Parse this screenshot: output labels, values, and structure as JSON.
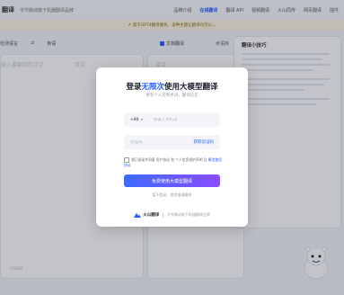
{
  "nav": {
    "brand": "翻译",
    "tagline": "字节跳动旗下机器翻译品牌",
    "menu": [
      "品牌介绍",
      "在线翻译",
      "翻译 API",
      "视频翻译",
      "火山同传",
      "网页翻译",
      "插件"
    ]
  },
  "notice": "✐ 基于GPT4翻译服务，多种主题让翻译也可以...",
  "toolbar": {
    "source_lang": "检测语言",
    "target_lang": "英语",
    "auto_label": "文档翻译",
    "glossary": "术语库"
  },
  "left_panel": {
    "placeholder": "输入要翻译的文字",
    "target_placeholder": "译文",
    "count": "0/5000"
  },
  "mid_panel": {
    "placeholder": "译文"
  },
  "tips": {
    "title": "翻译小技巧"
  },
  "modal": {
    "headline_pre": "登录",
    "headline_highlight": "无限次",
    "headline_post": "使用大模型翻译",
    "subtitle": "更有个人定制术语，翻译历史",
    "phone_code": "+86",
    "phone_placeholder": "请输入手机号",
    "code_placeholder": "验证码",
    "get_code": "获取验证码",
    "agree_text": "我已阅读并同意 用户协议 和 个人信息保护声明 及 ",
    "agree_link": "模型使用协议",
    "cta": "免费使用大模型翻译",
    "alt_login": "暂不登录，使用普通翻译",
    "footer_logo": "火山翻译",
    "footer_text": "字节跳动旗下机器翻译品牌"
  },
  "colors": {
    "accent": "#1f5cff",
    "gradient_start": "#3c6bff",
    "gradient_end": "#8b4dff"
  }
}
